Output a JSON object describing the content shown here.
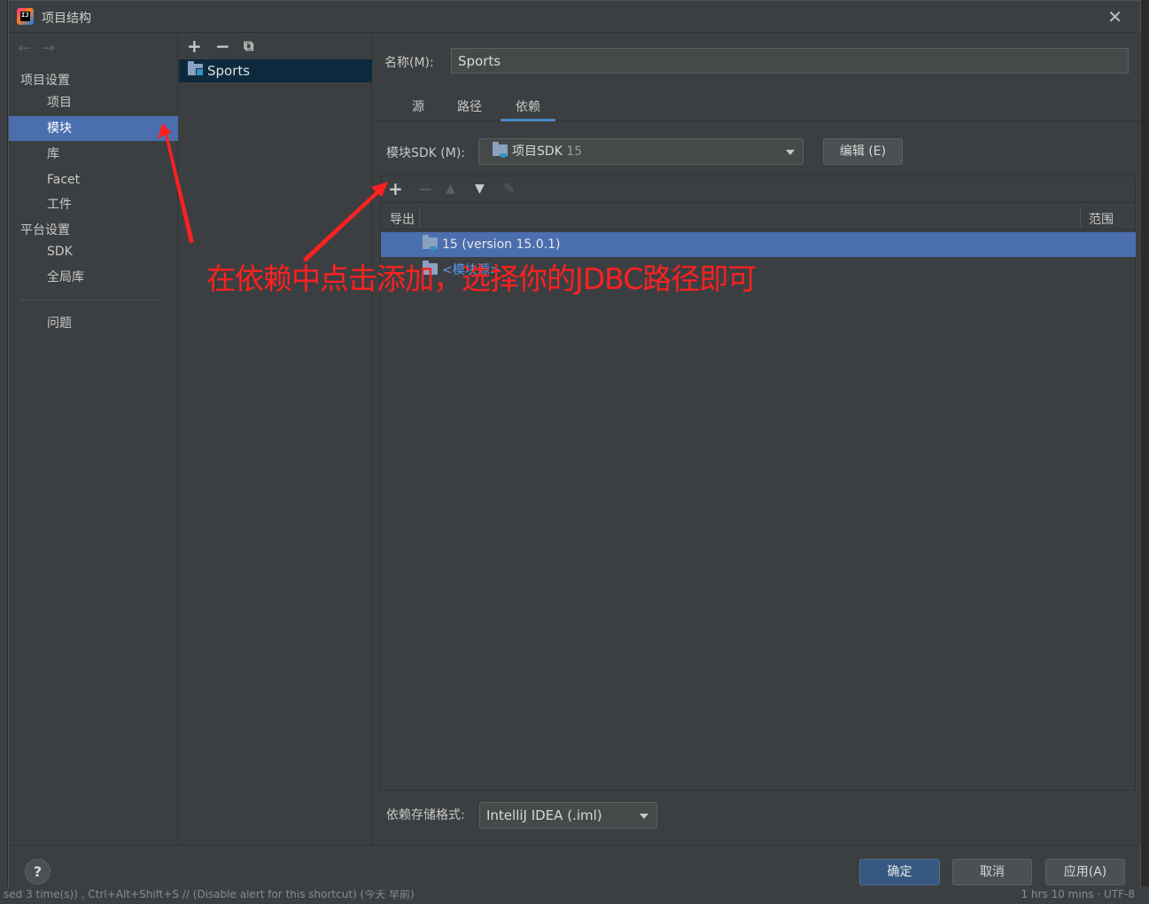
{
  "window": {
    "title": "项目结构"
  },
  "nav": {
    "project_settings_header": "项目设置",
    "platform_settings_header": "平台设置",
    "items": [
      {
        "label": "项目",
        "active": false
      },
      {
        "label": "模块",
        "active": true
      },
      {
        "label": "库",
        "active": false
      },
      {
        "label": "Facet",
        "active": false
      },
      {
        "label": "工件",
        "active": false
      },
      {
        "label": "SDK",
        "active": false
      },
      {
        "label": "全局库",
        "active": false
      },
      {
        "label": "问题",
        "active": false
      }
    ]
  },
  "modules": {
    "list": [
      {
        "name": "Sports"
      }
    ]
  },
  "main": {
    "name_label": "名称(M):",
    "name_value": "Sports",
    "tabs": [
      {
        "label": "源",
        "active": false
      },
      {
        "label": "路径",
        "active": false
      },
      {
        "label": "依赖",
        "active": true
      }
    ],
    "sdk_label": "模块SDK (M):",
    "sdk_value": "项目SDK",
    "sdk_version": "15",
    "edit_button": "编辑 (E)",
    "dep_columns": {
      "export": "导出",
      "scope": "范围"
    },
    "dependencies": [
      {
        "label": "15 (version 15.0.1)",
        "selected": true
      },
      {
        "label": "<模块源>",
        "selected": false
      }
    ],
    "storage_label": "依赖存储格式:",
    "storage_value": "IntelliJ IDEA (.iml)"
  },
  "footer": {
    "help": "?",
    "ok": "确定",
    "cancel": "取消",
    "apply": "应用(A)"
  },
  "annotation": {
    "text": "在依赖中点击添加，选择你的JDBC路径即可"
  },
  "background": {
    "status_left": "sed 3 time(s)) , Ctrl+Alt+Shift+S // (Disable alert for this shortcut) (今天 早前)",
    "status_right": "1 hrs 10 mins  ·  UTF-8"
  },
  "colors": {
    "accent": "#4b6eaf",
    "annotation": "#ff2020",
    "background": "#3c3f41"
  }
}
